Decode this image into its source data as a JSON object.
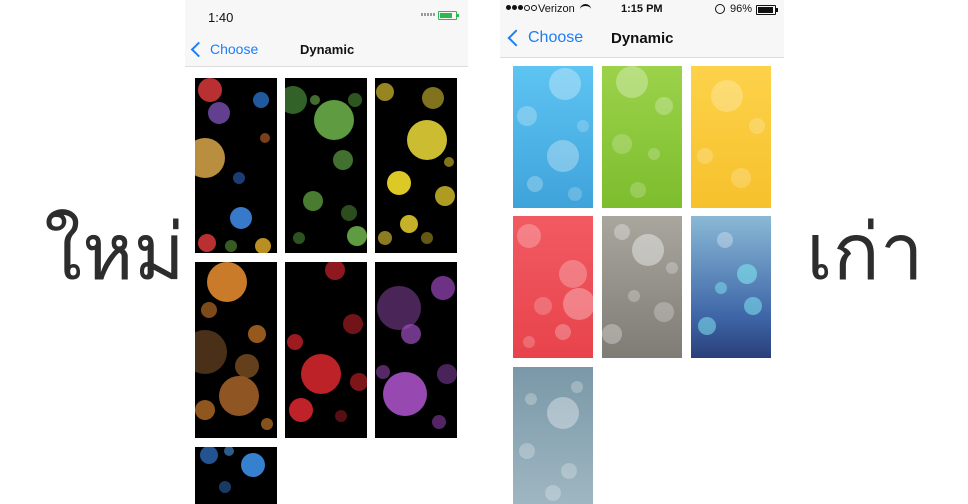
{
  "labels": {
    "new": "ใหม่",
    "old": "เก่า"
  },
  "new_screen": {
    "time": "1:40",
    "back_label": "Choose",
    "title": "Dynamic"
  },
  "old_screen": {
    "carrier": "Verizon",
    "time": "1:15 PM",
    "battery": "96%",
    "back_label": "Choose",
    "title": "Dynamic"
  },
  "colors": {
    "accent": "#1d7ef6",
    "new_tiles": [
      "#000000",
      "#000000",
      "#000000",
      "#000000",
      "#000000",
      "#000000",
      "#000000"
    ],
    "old_tiles": [
      "#4fb6ea",
      "#8fcc3c",
      "#f8cb3a",
      "#f25a62",
      "#8f8c85",
      "#4d7fb8",
      "#7a98a8"
    ]
  }
}
